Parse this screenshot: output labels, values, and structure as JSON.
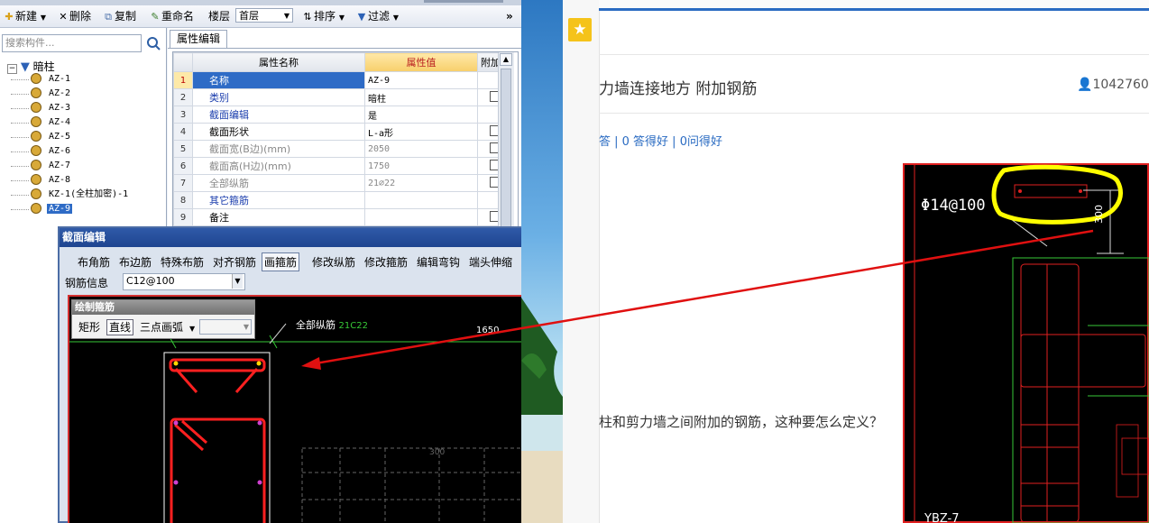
{
  "toolbar": {
    "new_label": "新建",
    "delete_label": "删除",
    "copy_label": "复制",
    "rename_label": "重命名",
    "floor_label": "楼层",
    "floor_value": "首层",
    "sort_label": "排序",
    "filter_label": "过滤",
    "more_label": "»"
  },
  "search": {
    "placeholder": "搜索构件..."
  },
  "tree": {
    "root_label": "暗柱",
    "items": [
      "AZ-1",
      "AZ-2",
      "AZ-3",
      "AZ-4",
      "AZ-5",
      "AZ-6",
      "AZ-7",
      "AZ-8",
      "KZ-1(全柱加密)-1",
      "AZ-9"
    ],
    "selected_index": 9
  },
  "properties": {
    "tab_label": "属性编辑",
    "headers": {
      "name": "属性名称",
      "value": "属性值",
      "extra": "附加"
    },
    "rows": [
      {
        "num": "1",
        "name": "名称",
        "value": "AZ-9",
        "style": "selected"
      },
      {
        "num": "2",
        "name": "类别",
        "value": "暗柱",
        "style": "blue"
      },
      {
        "num": "3",
        "name": "截面编辑",
        "value": "是",
        "style": "blue"
      },
      {
        "num": "4",
        "name": "截面形状",
        "value": "L-a形",
        "style": "normal"
      },
      {
        "num": "5",
        "name": "截面宽(B边)(mm)",
        "value": "2050",
        "style": "gray"
      },
      {
        "num": "6",
        "name": "截面高(H边)(mm)",
        "value": "1750",
        "style": "gray"
      },
      {
        "num": "7",
        "name": "全部纵筋",
        "value": "21⌀22",
        "style": "gray"
      },
      {
        "num": "8",
        "name": "其它箍筋",
        "value": "",
        "style": "blue"
      },
      {
        "num": "9",
        "name": "备注",
        "value": "",
        "style": "normal"
      }
    ]
  },
  "section_editor": {
    "title": "截面编辑",
    "toolbar": [
      "布角筋",
      "布边筋",
      "特殊布筋",
      "对齐钢筋",
      "画箍筋",
      "修改纵筋",
      "修改箍筋",
      "编辑弯钩",
      "端头伸缩"
    ],
    "active_tool": "画箍筋",
    "rebar_info_label": "钢筋信息",
    "rebar_info_value": "C12@100",
    "draw_panel_title": "绘制箍筋",
    "draw_modes": [
      "矩形",
      "直线",
      "三点画弧"
    ],
    "active_mode": "直线",
    "canvas_label_all_rebar": "全部纵筋",
    "canvas_label_rebar_value": "21C22",
    "canvas_dim_1650": "1650",
    "canvas_dim_300": "300"
  },
  "web": {
    "question_title": "力墙连接地方 附加钢筋",
    "user": "1042760..",
    "stats": "答 | 0 答得好 | 0问得好",
    "body_text": "柱和剪力墙之间附加的钢筋，这种要怎么定义？",
    "drawing_label_left": "Φ14@100",
    "drawing_label_right": "300",
    "drawing_label_bottom": "YBZ-7"
  },
  "colors": {
    "dialog_title": "#1e4590",
    "canvas_bg": "#000000",
    "rebar_red": "#ff2020",
    "highlight_yellow": "#ffff00",
    "arrow_red": "#e01010",
    "link_blue": "#2a6bc2"
  }
}
